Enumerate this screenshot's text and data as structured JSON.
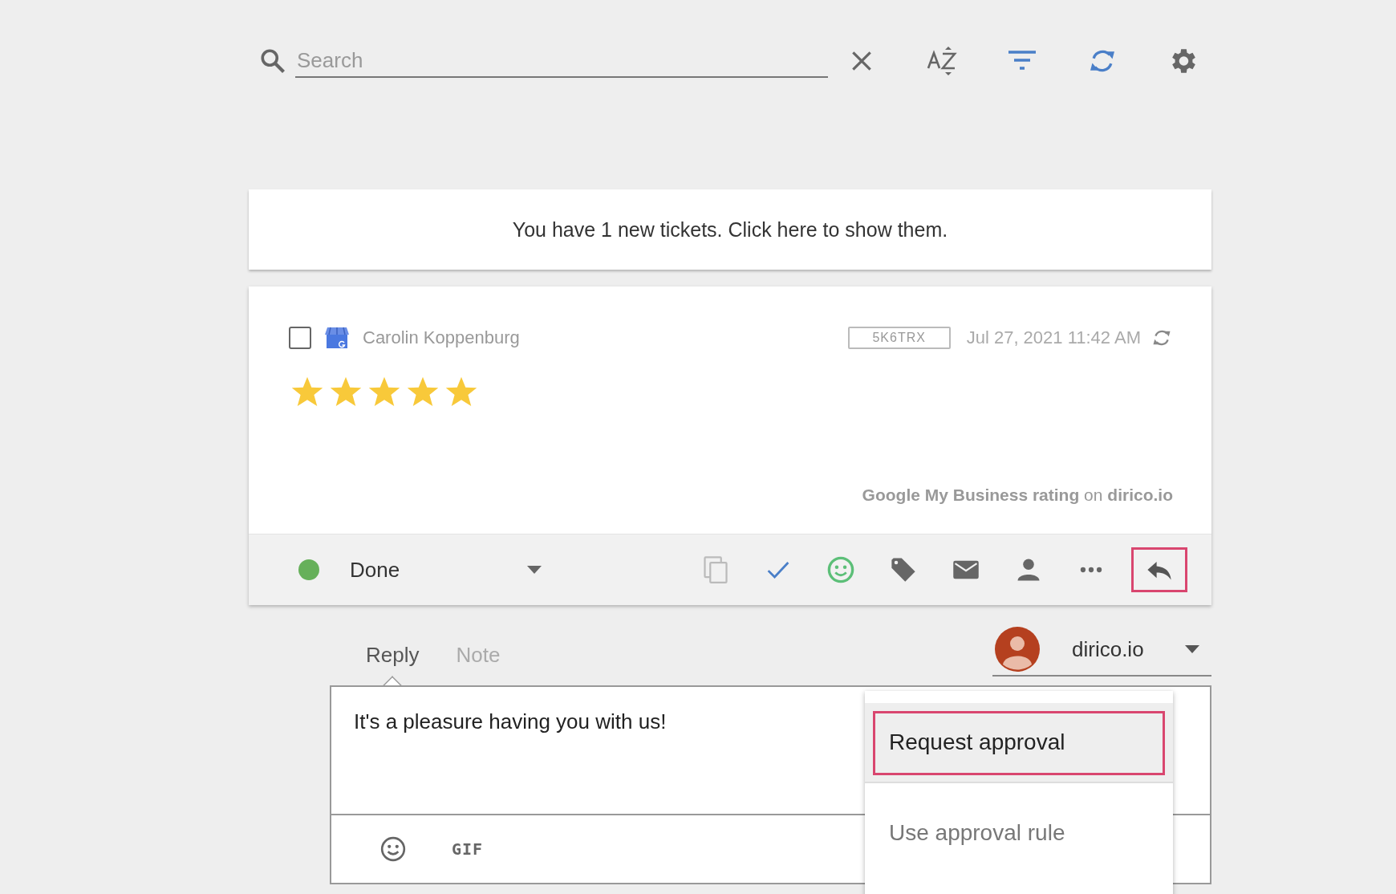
{
  "search": {
    "placeholder": "Search"
  },
  "notice": "You have 1 new tickets. Click here to show them.",
  "ticket": {
    "checked": false,
    "author": "Carolin Koppenburg",
    "ticket_id": "5K6TRX",
    "date": "Jul 27, 2021 11:42 AM",
    "stars": 5,
    "source": "**Google My Business rating** on **dirico.io**",
    "status": {
      "label": "Done",
      "color": "#66b05a"
    },
    "actions": [
      {
        "kind": "copy",
        "selected": false
      },
      {
        "kind": "check",
        "selected": false
      },
      {
        "kind": "smiley",
        "selected": false
      },
      {
        "kind": "tag",
        "selected": false
      },
      {
        "kind": "mail",
        "selected": false
      },
      {
        "kind": "person",
        "selected": false
      },
      {
        "kind": "more",
        "selected": false
      },
      {
        "kind": "reply",
        "selected": true
      }
    ]
  },
  "composer": {
    "tabs": [
      {
        "label": "Reply",
        "selected": true
      },
      {
        "label": "Note",
        "selected": false
      }
    ],
    "sender": "dirico.io",
    "text": "It's a pleasure having you with us!",
    "gif": "GIF",
    "menu": [
      {
        "label": "Request approval",
        "selected": true
      },
      {
        "label": "Use approval rule",
        "selected": false
      }
    ]
  }
}
